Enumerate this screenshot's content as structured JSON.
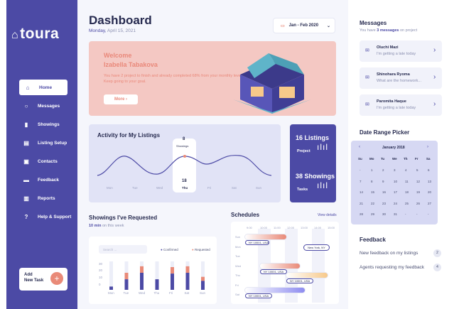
{
  "brand": {
    "logo": "toura"
  },
  "nav": [
    {
      "label": "Home",
      "icon": "home-icon",
      "glyph": "⌂"
    },
    {
      "label": "Messages",
      "icon": "chat-icon",
      "glyph": "○"
    },
    {
      "label": "Showings",
      "icon": "bar-chart-icon",
      "glyph": "▮"
    },
    {
      "label": "Listing Setup",
      "icon": "list-icon",
      "glyph": "▤"
    },
    {
      "label": "Contacts",
      "icon": "contact-card-icon",
      "glyph": "▣"
    },
    {
      "label": "Feedback",
      "icon": "feedback-icon",
      "glyph": "▬"
    },
    {
      "label": "Reports",
      "icon": "report-icon",
      "glyph": "▥"
    },
    {
      "label": "Help & Support",
      "icon": "help-icon",
      "glyph": "?"
    }
  ],
  "addtask": {
    "line1": "Add",
    "line2": "New Task",
    "btn": "+"
  },
  "header": {
    "title": "Dashboard",
    "day": "Monday,",
    "date": " April 15, 2021",
    "range": "Jan - Feb 2020"
  },
  "welcome": {
    "line1": "Welcome",
    "line2": "Izabella Tabakova",
    "text": "You have 2 project to finish and already completed 68% from your monthly level. Keep going to your goal.",
    "more": "More  ›"
  },
  "activity": {
    "title": "Activity for My Listings",
    "days": [
      "Mon",
      "Tue",
      "Wed",
      "Thu",
      "Fri",
      "Sat",
      "Sun"
    ],
    "tooltip_top": "8",
    "tooltip_label": "Showings",
    "tooltip_bottom": "18"
  },
  "stats": [
    {
      "num": "16 Listings",
      "label": "Project"
    },
    {
      "num": "38 Showings",
      "label": "Tasks"
    }
  ],
  "showings": {
    "title": "Showings I've Requested",
    "sub_b": "10 min",
    "sub": " on this week",
    "search": "Search ...",
    "legend": [
      {
        "label": "Confirmed",
        "color": "#4c4aa5"
      },
      {
        "label": "Requested",
        "color": "#e98a78"
      }
    ],
    "yticks": [
      "30",
      "20",
      "10",
      "0"
    ],
    "days": [
      "Mon",
      "Tue",
      "Wed",
      "Thu",
      "Fri",
      "Sat",
      "Sun"
    ]
  },
  "chart_data": {
    "type": "bar",
    "categories": [
      "Mon",
      "Tue",
      "Wed",
      "Thu",
      "Fri",
      "Sat",
      "Sun"
    ],
    "series": [
      {
        "name": "Confirmed",
        "values": [
          4,
          13,
          21,
          13,
          20,
          21,
          11
        ]
      },
      {
        "name": "Requested",
        "values": [
          0,
          8,
          8,
          0,
          8,
          8,
          5
        ]
      }
    ],
    "ylim": [
      0,
      35
    ]
  },
  "schedules": {
    "title": "Schedules",
    "link": "View details",
    "times": [
      "9:00",
      "10:00",
      "11:00",
      "12:00",
      "13:00",
      "14:00",
      "15:00"
    ],
    "days": [
      "Sun",
      "Mon",
      "Tue",
      "Wed",
      "Thu",
      "Fri",
      "Sat"
    ],
    "events": [
      "NY 10001, USA",
      "New York, NY",
      "NY 10001, USA",
      "NY 10001, USA",
      "NY 10001, USA"
    ]
  },
  "messages": {
    "title": "Messages",
    "sub1": "You have ",
    "sub_b": "3 messages",
    "sub2": " on project",
    "items": [
      {
        "name": "Oluchi Mazi",
        "preview": "I'm getting a late today"
      },
      {
        "name": "Shinohara Ryoma",
        "preview": "What are the homework..."
      },
      {
        "name": "Paromita Haque",
        "preview": "I'm getting a late today"
      }
    ]
  },
  "calendar": {
    "title": "Date Range Picker",
    "month": "January 2018",
    "weekdays": [
      "Su",
      "Mo",
      "Tu",
      "We",
      "Th",
      "Fr",
      "Sa"
    ],
    "days": [
      "-",
      "1",
      "2",
      "3",
      "4",
      "5",
      "6",
      "7",
      "8",
      "9",
      "10",
      "11",
      "12",
      "13",
      "14",
      "15",
      "16",
      "17",
      "18",
      "19",
      "20",
      "21",
      "22",
      "23",
      "24",
      "25",
      "26",
      "27",
      "28",
      "29",
      "30",
      "31",
      "-",
      "-",
      "-"
    ]
  },
  "feedback": {
    "title": "Feedback",
    "items": [
      {
        "label": "New feedback on my listings",
        "count": "2"
      },
      {
        "label": "Agents requesting my feedback",
        "count": "4"
      }
    ]
  }
}
